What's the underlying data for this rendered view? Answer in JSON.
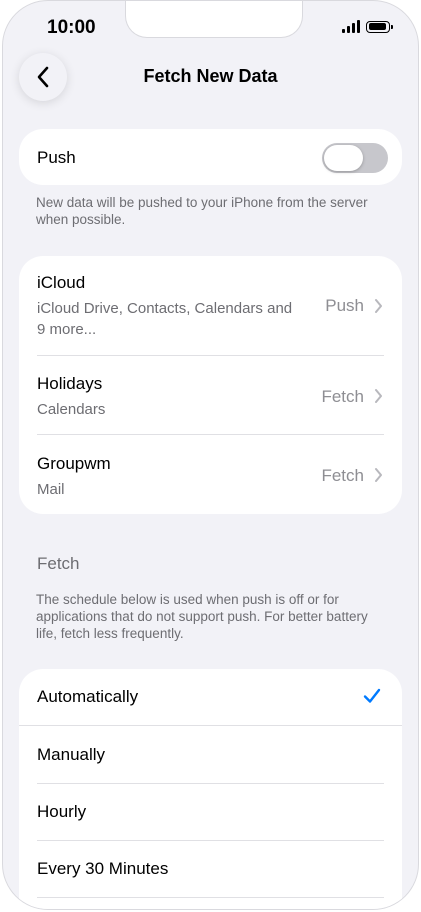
{
  "status_bar": {
    "time": "10:00"
  },
  "nav": {
    "title": "Fetch New Data"
  },
  "push": {
    "label": "Push",
    "enabled": false,
    "footnote": "New data will be pushed to your iPhone from the server when possible."
  },
  "accounts": [
    {
      "name": "iCloud",
      "detail_line1": "iCloud Drive, Contacts, Calendars and",
      "detail_line2": "9 more...",
      "mode": "Push"
    },
    {
      "name": "Holidays",
      "detail_line1": "Calendars",
      "mode": "Fetch"
    },
    {
      "name": "Groupwm",
      "detail_line1": "Mail",
      "mode": "Fetch"
    }
  ],
  "fetch": {
    "header": "Fetch",
    "footnote": "The schedule below is used when push is off or for applications that do not support push. For better battery life, fetch less frequently.",
    "options": [
      "Automatically",
      "Manually",
      "Hourly",
      "Every 30 Minutes"
    ],
    "selected": "Automatically"
  },
  "colors": {
    "accent": "#007aff",
    "background": "#f2f2f7",
    "secondary_text": "#6d6d72"
  }
}
